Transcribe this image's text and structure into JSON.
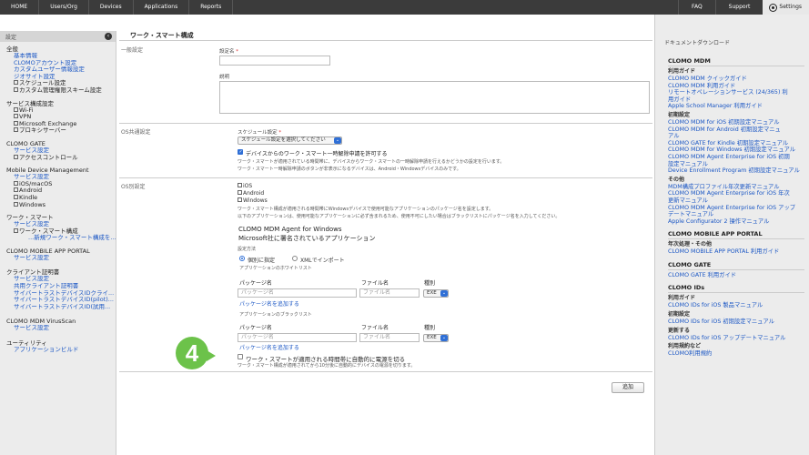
{
  "topnav": {
    "items": [
      "HOME",
      "Users/Org",
      "Devices",
      "Applications",
      "Reports"
    ],
    "right": [
      "FAQ",
      "Support"
    ],
    "settings": "Settings"
  },
  "sidebar": {
    "header": "設定",
    "groups": [
      {
        "title": "全般",
        "links": [
          "基本情報",
          "CLOMOアカウント設定",
          "カスタムユーザー情報設定",
          "ジオサイト設定"
        ],
        "subs": [
          "スケジュール設定",
          "カスタム管理権限スキーム設定"
        ]
      },
      {
        "title": "サービス構成設定",
        "subs": [
          "Wi-Fi",
          "VPN",
          "Microsoft Exchange",
          "プロキシサーバー"
        ]
      },
      {
        "title": "CLOMO GATE",
        "links": [
          "サービス設定"
        ],
        "subs": [
          "アクセスコントロール"
        ]
      },
      {
        "title": "Mobile Device Management",
        "links": [
          "サービス設定"
        ],
        "subs": [
          "iOS/macOS",
          "Android",
          "Kindle",
          "Windows"
        ]
      },
      {
        "title": "ワーク・スマート",
        "links": [
          "サービス設定"
        ],
        "subs": [
          "ワーク・スマート構成"
        ],
        "deep": [
          "...新規ワーク・スマート構成を..."
        ]
      },
      {
        "title": "CLOMO MOBILE APP PORTAL",
        "links": [
          "サービス設定"
        ]
      },
      {
        "title": "クライアント証明書",
        "links": [
          "サービス設定",
          "共用クライアント証明書",
          "サイバートラストデバイスIDクライ...",
          "サイバートラストデバイスID(pilot)...",
          "サイバートラストデバイスID(試用..."
        ]
      },
      {
        "title": "CLOMO MDM VirusScan",
        "links": [
          "サービス設定"
        ]
      },
      {
        "title": "ユーティリティ",
        "links": [
          "アプリケーションビルド"
        ]
      }
    ]
  },
  "main": {
    "title": "ワーク・スマート構成",
    "general": {
      "section": "一般設定",
      "name_label": "設定名",
      "desc_label": "説明"
    },
    "os_common": {
      "section": "OS共通設定",
      "schedule_label": "スケジュール設定",
      "schedule_value": "スケジュール設定を選択してください",
      "allow_unlock_label": "デバイスからのワーク・スマート一時解除申請を許可する",
      "note1": "ワーク・スマートが適用されている時間帯に、デバイスからワーク・スマートの一時解除申請を行えるかどうかの設定を行います。",
      "note2": "ワーク・スマート一時解除申請のボタンが非表示になるデバイスは、Android・Windowsデバイスのみです。"
    },
    "os_specific": {
      "section": "OS別設定",
      "os_list": [
        "iOS",
        "Android",
        "Windows"
      ],
      "note1": "ワーク・スマート構成が適用される時間帯にWindowsデバイスで使用可能なアプリケーションのパッケージ名を設定します。",
      "note2": "以下のアプリケーションは、使用可能なアプリケーションに必ず含まれるため、使用不可にしたい場合はブラックリストにパッケージ名を入力してください。",
      "agent_line1": "CLOMO MDM Agent for Windows",
      "agent_line2": "Microsoft社に署名されているアプリケーション",
      "method_label": "設定方法",
      "radio_individual": "個別に指定",
      "radio_xml": "XMLでインポート",
      "whitelist_label": "アプリケーションのホワイトリスト",
      "blacklist_label": "アプリケーションのブラックリスト",
      "col_package": "パッケージ名",
      "col_file": "ファイル名",
      "col_type": "種別",
      "ph_package": "パッケージ名",
      "ph_file": "ファイル名",
      "type_value": "EXE",
      "add_package": "パッケージ名を追加する",
      "power_label": "ワーク・スマートが適用される時間帯に自動的に電源を切る",
      "power_note": "ワーク・スマート構成が適用されてから10分後に自動的にデバイスの電源を切ります。"
    },
    "add_button": "追加",
    "badge": "4"
  },
  "rpanel": {
    "title": "ドキュメントダウンロード",
    "sections": [
      {
        "title": "CLOMO MDM",
        "blocks": [
          {
            "sub": "利用ガイド",
            "links": [
              "CLOMO MDM クイックガイド",
              "CLOMO MDM 利用ガイド",
              "リモートオペレーションサービス (24/365) 利",
              "用ガイド",
              "Apple School Manager 利用ガイド"
            ]
          },
          {
            "sub": "初期設定",
            "links": [
              "CLOMO MDM for iOS 初期設定マニュアル",
              "CLOMO MDM for Android 初期設定マニュ",
              "アル",
              "CLOMO GATE for Kindle 初期設定マニュアル",
              "CLOMO MDM for Windows 初期設定マニュアル",
              "CLOMO MDM Agent Enterprise for iOS 初期",
              "設定マニュアル",
              "Device Enrollment Program 初期設定マニュアル"
            ]
          },
          {
            "sub": "その他",
            "links": [
              "MDM構成プロファイル年次更新マニュアル",
              "CLOMO MDM Agent Enterprise for iOS 年次",
              "更新マニュアル",
              "CLOMO MDM Agent Enterprise for iOS アップ",
              "デートマニュアル",
              "Apple Configurator 2 操作マニュアル"
            ]
          }
        ]
      },
      {
        "title": "CLOMO MOBILE APP PORTAL",
        "blocks": [
          {
            "sub": "年次処理・その他",
            "links": [
              "CLOMO MOBILE APP PORTAL 利用ガイド"
            ]
          }
        ]
      },
      {
        "title": "CLOMO GATE",
        "blocks": [
          {
            "sub": "",
            "links": [
              "CLOMO GATE 利用ガイド"
            ]
          }
        ]
      },
      {
        "title": "CLOMO IDs",
        "blocks": [
          {
            "sub": "利用ガイド",
            "links": [
              "CLOMO IDs for iOS 製品マニュアル"
            ]
          },
          {
            "sub": "初期設定",
            "links": [
              "CLOMO IDs for iOS 初期設定マニュアル"
            ]
          },
          {
            "sub": "更新する",
            "links": [
              "CLOMO IDs for iOS アップデートマニュアル"
            ]
          },
          {
            "sub": "利用規約など",
            "links": [
              "CLOMO利用規約"
            ]
          }
        ]
      }
    ]
  }
}
